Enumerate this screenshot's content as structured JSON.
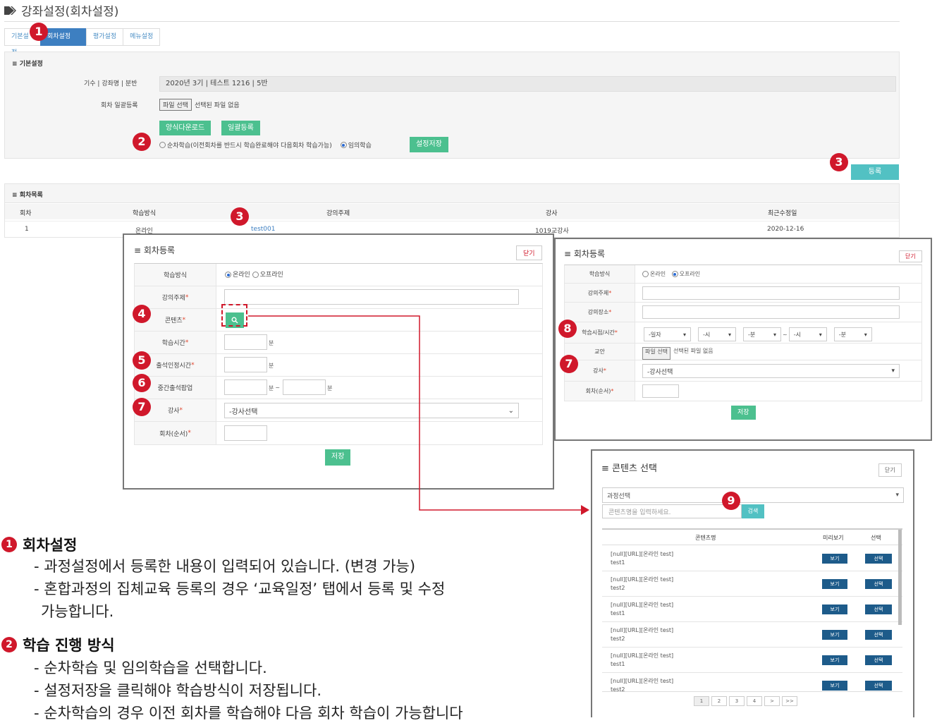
{
  "page": {
    "title": "강좌설정(회차설정)"
  },
  "tabs": [
    {
      "label": "기본설정"
    },
    {
      "label": "회차설정"
    },
    {
      "label": "평가설정"
    },
    {
      "label": "메뉴설정"
    }
  ],
  "basic": {
    "section_title": "기본설정",
    "course_label": "기수 | 강좌명 | 분반",
    "course_value": "2020년 3기 | 테스트 1216 | 5반",
    "bulk_label": "회차 일괄등록",
    "file_button": "파일 선택",
    "file_none": "선택된 파일 없음",
    "download_button": "양식다운로드",
    "bulk_button": "일괄등록",
    "sequential_label": "순차학습(이전회차를 반드시 학습완료해야 다음회차 학습가능)",
    "random_label": "임의학습",
    "save_setting_button": "설정저장",
    "register_button": "등록"
  },
  "list": {
    "section_title": "회차목록",
    "columns": [
      "회차",
      "학습방식",
      "강의주제",
      "강사",
      "최근수정일"
    ],
    "rows": [
      [
        "1",
        "온라인",
        "test001",
        "1019교강사",
        "2020-12-16"
      ]
    ]
  },
  "modal_online": {
    "title": "회차등록",
    "close": "닫기",
    "method_label": "학습방식",
    "online": "온라인",
    "offline": "오프라인",
    "topic_label": "강의주제",
    "content_label": "콘텐츠",
    "time_label": "학습시간",
    "attend_label": "출석인정시간",
    "popup_label": "중간출석팝업",
    "teacher_label": "강사",
    "teacher_placeholder": "-강사선택",
    "order_label": "회차(순서)",
    "unit": "분",
    "tilde": "~",
    "save": "저장"
  },
  "modal_offline": {
    "title": "회차등록",
    "close": "닫기",
    "method_label": "학습방식",
    "online": "온라인",
    "offline": "오프라인",
    "topic_label": "강의주제",
    "place_label": "강의장소",
    "datetime_label": "학습시점/시간",
    "sel_date": "-일자",
    "sel_hour": "-시",
    "sel_min": "-분",
    "tilde": "~",
    "textbook_label": "교안",
    "file_button": "파일 선택",
    "file_none": "선택된 파일 없음",
    "teacher_label": "강사",
    "teacher_placeholder": "-강사선택",
    "order_label": "회차(순서)",
    "save": "저장"
  },
  "modal_content": {
    "title": "콘텐츠 선택",
    "close": "닫기",
    "course_select": "과정선택",
    "search_placeholder": "콘텐츠명을 입력하세요.",
    "search_button": "검색",
    "col_name": "콘텐츠명",
    "col_preview": "미리보기",
    "col_select": "선택",
    "view": "보기",
    "select": "선택",
    "rows": [
      {
        "line1": "[null][URL][온라인 test]",
        "line2": "test1"
      },
      {
        "line1": "[null][URL][온라인 test]",
        "line2": "test2"
      },
      {
        "line1": "[null][URL][온라인 test]",
        "line2": "test1"
      },
      {
        "line1": "[null][URL][온라인 test]",
        "line2": "test2"
      },
      {
        "line1": "[null][URL][온라인 test]",
        "line2": "test1"
      },
      {
        "line1": "[null][URL][온라인 test]",
        "line2": "test2"
      }
    ],
    "pages": [
      "1",
      "2",
      "3",
      "4",
      ">",
      ">>"
    ]
  },
  "markers": [
    "1",
    "2",
    "3",
    "3",
    "4",
    "5",
    "6",
    "7",
    "7",
    "8",
    "9"
  ],
  "annotations": {
    "a1_num": "1",
    "a1_title": "회차설정",
    "a1_lines": [
      "- 과정설정에서 등록한 내용이 입력되어 있습니다. (변경 가능)",
      "- 혼합과정의 집체교육 등록의 경우 ‘교육일정’ 탭에서 등록 및 수정",
      "가능합니다."
    ],
    "a2_num": "2",
    "a2_title": "학습 진행 방식",
    "a2_lines": [
      "- 순차학습 및 임의학습을 선택합니다.",
      "- 설정저장을 클릭해야 학습방식이 저장됩니다.",
      "- 순차학습의 경우 이전 회차를 학습해야 다음 회차 학습이 가능합니다"
    ]
  },
  "colors": {
    "marker": "#d0182b",
    "tab_active": "#3d7fc1",
    "green": "#4cc08f",
    "teal": "#52c1c3",
    "navy": "#1d5b8a",
    "arrow": "#d0182b"
  }
}
